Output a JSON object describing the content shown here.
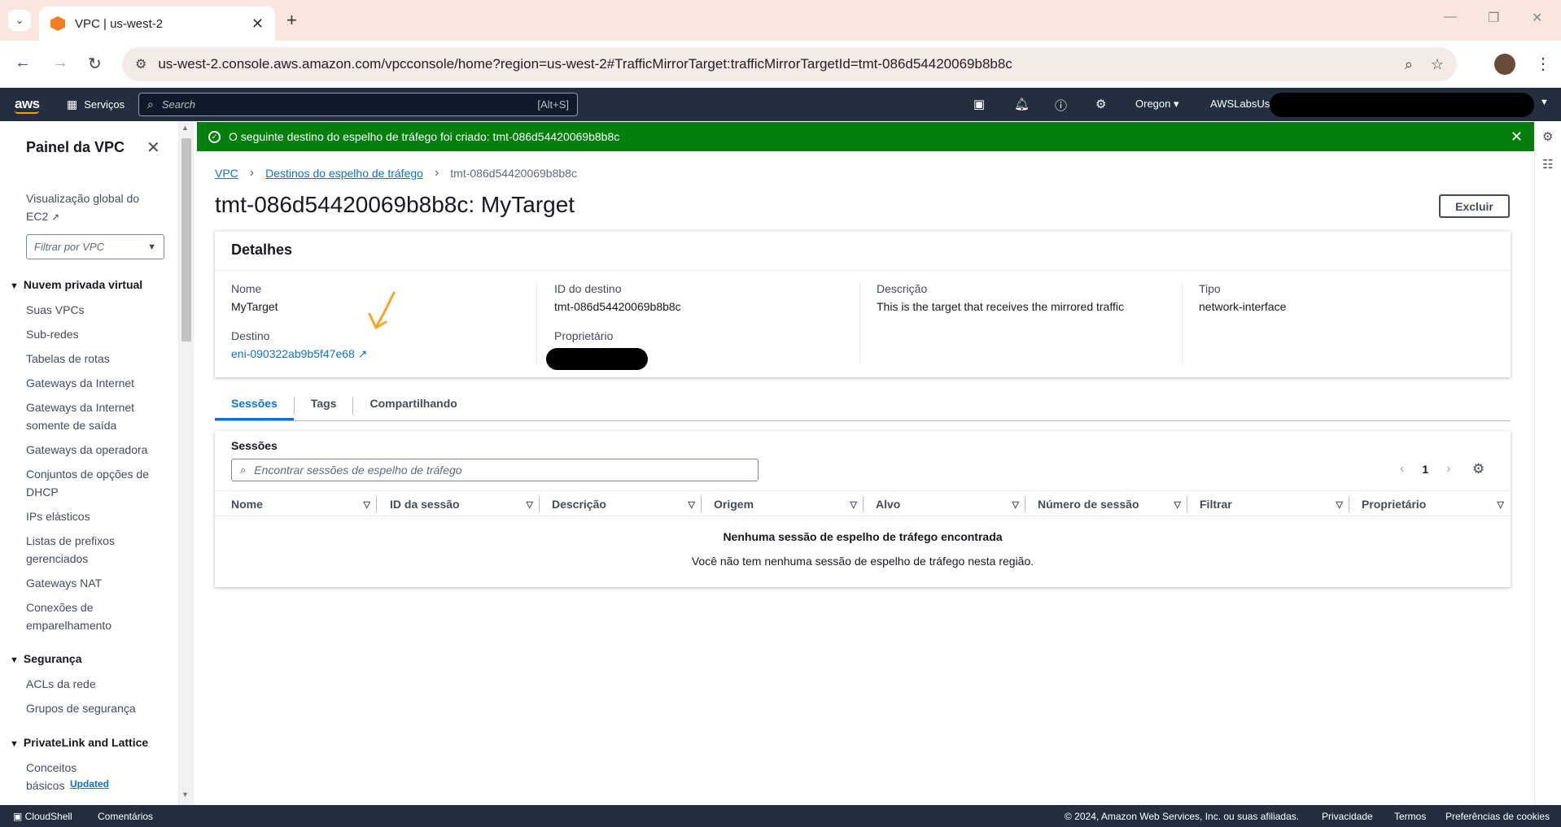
{
  "browser": {
    "tab_title": "VPC | us-west-2",
    "url": "us-west-2.console.aws.amazon.com/vpcconsole/home?region=us-west-2#TrafficMirrorTarget:trafficMirrorTargetId=tmt-086d54420069b8b8c"
  },
  "aws_nav": {
    "logo": "aws",
    "services": "Serviços",
    "search_placeholder": "Search",
    "search_shortcut": "[Alt+S]",
    "region": "Oregon ▾",
    "user": "AWSLabsUser"
  },
  "sidebar": {
    "title": "Painel da VPC",
    "global_view": "Visualização global do EC2",
    "filter_placeholder": "Filtrar por VPC",
    "section_vpc": "Nuvem privada virtual",
    "vpc_items": [
      "Suas VPCs",
      "Sub-redes",
      "Tabelas de rotas",
      "Gateways da Internet",
      "Gateways da Internet somente de saída",
      "Gateways da operadora",
      "Conjuntos de opções de DHCP",
      "IPs elásticos",
      "Listas de prefixos gerenciados",
      "Gateways NAT",
      "Conexões de emparelhamento"
    ],
    "section_security": "Segurança",
    "security_items": [
      "ACLs da rede",
      "Grupos de segurança"
    ],
    "section_privatelink": "PrivateLink and Lattice",
    "privatelink_item": "Conceitos básicos",
    "updated_badge": "Updated"
  },
  "flash": {
    "message": "O seguinte destino do espelho de tráfego foi criado: tmt-086d54420069b8b8c"
  },
  "breadcrumb": {
    "root": "VPC",
    "parent": "Destinos do espelho de tráfego",
    "current": "tmt-086d54420069b8b8c"
  },
  "page": {
    "title": "tmt-086d54420069b8b8c: MyTarget",
    "delete_label": "Excluir"
  },
  "details": {
    "header": "Detalhes",
    "name_label": "Nome",
    "name_value": "MyTarget",
    "dest_label": "Destino",
    "dest_value": "eni-090322ab9b5f47e68",
    "id_label": "ID do destino",
    "id_value": "tmt-086d54420069b8b8c",
    "owner_label": "Proprietário",
    "desc_label": "Descrição",
    "desc_value": "This is the target that receives the mirrored traffic",
    "type_label": "Tipo",
    "type_value": "network-interface"
  },
  "tabs": [
    "Sessões",
    "Tags",
    "Compartilhando"
  ],
  "sessions": {
    "title": "Sessões",
    "search_placeholder": "Encontrar sessões de espelho de tráfego",
    "page": "1",
    "columns": [
      "Nome",
      "ID da sessão",
      "Descrição",
      "Origem",
      "Alvo",
      "Número de sessão",
      "Filtrar",
      "Proprietário"
    ],
    "empty_title": "Nenhuma sessão de espelho de tráfego encontrada",
    "empty_sub": "Você não tem nenhuma sessão de espelho de tráfego nesta região."
  },
  "footer": {
    "cloudshell": "CloudShell",
    "feedback": "Comentários",
    "copyright": "© 2024, Amazon Web Services, Inc. ou suas afiliadas.",
    "privacy": "Privacidade",
    "terms": "Termos",
    "cookies": "Preferências de cookies"
  }
}
